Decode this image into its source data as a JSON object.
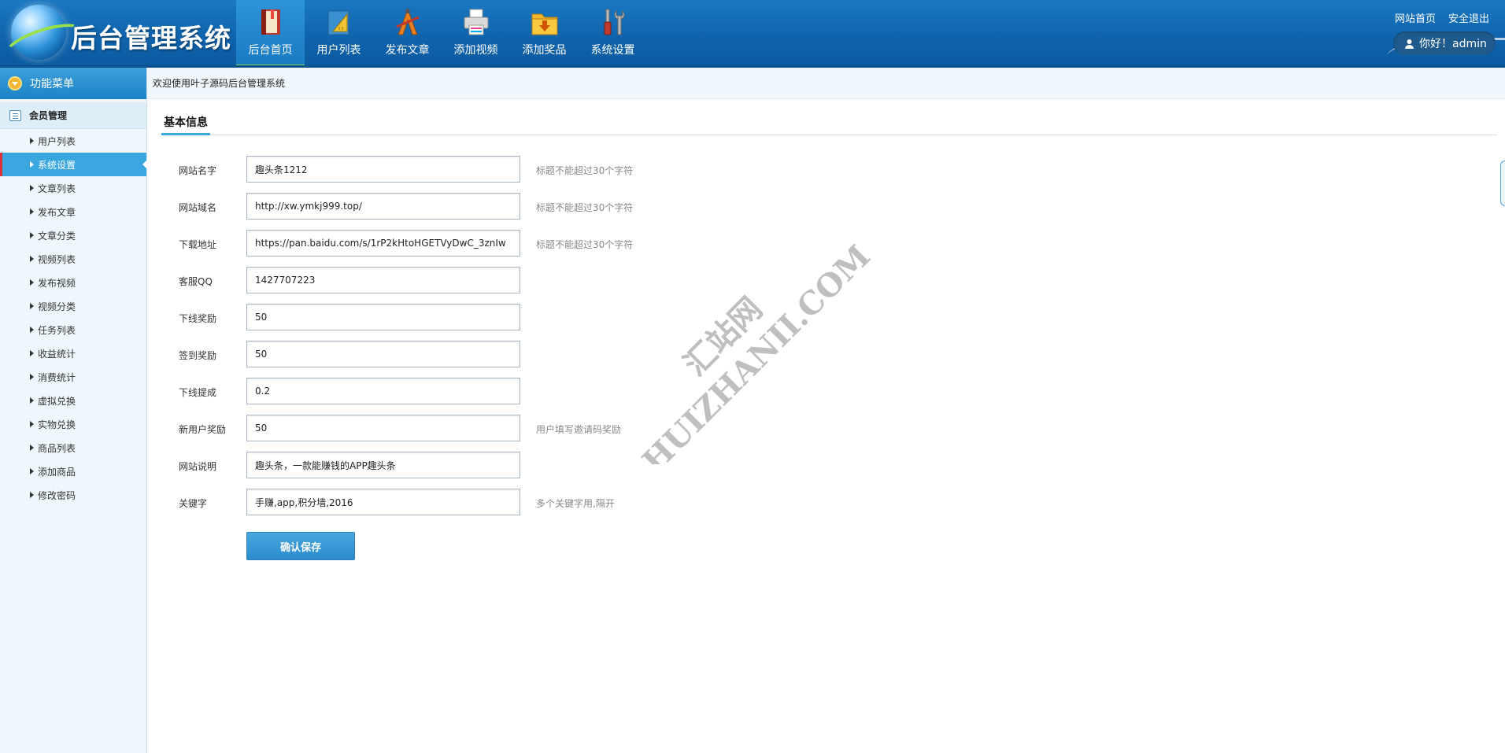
{
  "header": {
    "app_title": "后台管理系统",
    "nav": [
      {
        "label": "后台首页",
        "icon": "book-icon",
        "active": true
      },
      {
        "label": "用户列表",
        "icon": "ruler-icon",
        "active": false
      },
      {
        "label": "发布文章",
        "icon": "pencil-compass-icon",
        "active": false
      },
      {
        "label": "添加视频",
        "icon": "printer-icon",
        "active": false
      },
      {
        "label": "添加奖品",
        "icon": "folder-download-icon",
        "active": false
      },
      {
        "label": "系统设置",
        "icon": "tools-icon",
        "active": false
      }
    ],
    "site_home": "网站首页",
    "logout": "安全退出",
    "greeting": "你好！admin"
  },
  "sidebar": {
    "title": "功能菜单",
    "group": "会员管理",
    "items": [
      {
        "label": "用户列表"
      },
      {
        "label": "系统设置",
        "active": true
      },
      {
        "label": "文章列表"
      },
      {
        "label": "发布文章"
      },
      {
        "label": "文章分类"
      },
      {
        "label": "视频列表"
      },
      {
        "label": "发布视频"
      },
      {
        "label": "视频分类"
      },
      {
        "label": "任务列表"
      },
      {
        "label": "收益统计"
      },
      {
        "label": "消费统计"
      },
      {
        "label": "虚拟兑换"
      },
      {
        "label": "实物兑换"
      },
      {
        "label": "商品列表"
      },
      {
        "label": "添加商品"
      },
      {
        "label": "修改密码"
      }
    ]
  },
  "main": {
    "breadcrumb": "欢迎使用叶子源码后台管理系统",
    "section_title": "基本信息",
    "fields": [
      {
        "label": "网站名字",
        "value": "趣头条1212",
        "hint": "标题不能超过30个字符"
      },
      {
        "label": "网站域名",
        "value": "http://xw.ymkj999.top/",
        "hint": "标题不能超过30个字符"
      },
      {
        "label": "下载地址",
        "value": "https://pan.baidu.com/s/1rP2kHtoHGETVyDwC_3znIw",
        "hint": "标题不能超过30个字符"
      },
      {
        "label": "客服QQ",
        "value": "1427707223",
        "hint": ""
      },
      {
        "label": "下线奖励",
        "value": "50",
        "hint": ""
      },
      {
        "label": "签到奖励",
        "value": "50",
        "hint": ""
      },
      {
        "label": "下线提成",
        "value": "0.2",
        "hint": ""
      },
      {
        "label": "新用户奖励",
        "value": "50",
        "hint": "用户填写邀请码奖励"
      },
      {
        "label": "网站说明",
        "value": "趣头条，一款能赚钱的APP趣头条",
        "hint": ""
      },
      {
        "label": "关键字",
        "value": "手赚,app,积分墙,2016",
        "hint": "多个关键字用,隔开"
      }
    ],
    "submit_label": "确认保存"
  },
  "watermark": {
    "line1": "汇站网",
    "line2": "HUIZHANII.COM"
  },
  "colors": {
    "header_blue": "#0f64ad",
    "active_green": "#8dd14a",
    "sidebar_active": "#3ba7e0",
    "active_marker": "#e0303a"
  }
}
